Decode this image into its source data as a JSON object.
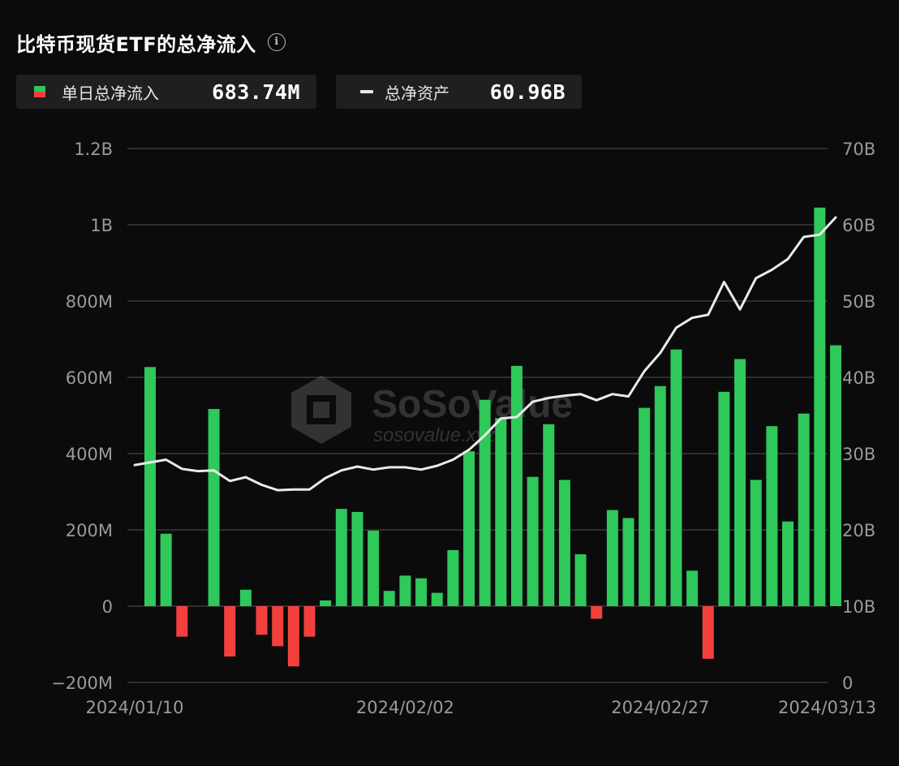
{
  "header": {
    "title": "比特币现货ETF的总净流入",
    "info_icon": "info-icon"
  },
  "legend": [
    {
      "label": "单日总净流入",
      "value": "683.74M",
      "swatch": "split-green-red"
    },
    {
      "label": "总净资产",
      "value": "60.96B",
      "swatch": "white-line"
    }
  ],
  "watermark": {
    "brand": "SoSoValue",
    "url": "sosovalue.xyz"
  },
  "colors": {
    "positive": "#2fc85a",
    "negative": "#f2413d",
    "line": "#eaeaea",
    "grid": "#3a3a3a",
    "tick": "#9a9a9a"
  },
  "chart_data": {
    "type": "bar",
    "series": [
      {
        "type": "bar",
        "axis": "left",
        "unit": "M",
        "values": [
          627,
          190,
          -80,
          0,
          517,
          -132,
          43,
          -75,
          -105,
          -158,
          -80,
          15,
          255,
          247,
          198,
          40,
          80,
          73,
          35,
          147,
          406,
          541,
          493,
          630,
          339,
          477,
          331,
          136,
          -33,
          252,
          231,
          520,
          577,
          673,
          93,
          -138,
          562,
          648,
          331,
          472,
          222,
          505,
          1045,
          684
        ]
      },
      {
        "type": "line",
        "axis": "right",
        "unit": "B",
        "values": [
          28.5,
          29.2,
          28.0,
          27.7,
          27.8,
          26.4,
          26.9,
          25.9,
          25.2,
          25.3,
          25.3,
          26.8,
          27.8,
          28.3,
          27.9,
          28.2,
          28.2,
          27.9,
          28.4,
          29.2,
          30.5,
          32.4,
          34.6,
          34.8,
          36.8,
          37.3,
          37.6,
          37.8,
          37.0,
          37.8,
          37.5,
          40.8,
          43.2,
          46.5,
          47.8,
          48.2,
          52.5,
          48.9,
          53.0,
          54.1,
          55.5,
          58.4,
          58.7,
          60.96
        ]
      }
    ],
    "x_ticks": [
      {
        "label": "2024/01/10",
        "index": 0
      },
      {
        "label": "2024/02/02",
        "index": 16
      },
      {
        "label": "2024/02/27",
        "index": 32
      },
      {
        "label": "2024/03/13",
        "index": 43
      }
    ],
    "left_axis": {
      "range": [
        -200,
        1200
      ],
      "ticks": [
        -200,
        0,
        200,
        400,
        600,
        800,
        1000,
        1200
      ],
      "tick_labels": [
        "−200M",
        "0",
        "200M",
        "400M",
        "600M",
        "800M",
        "1B",
        "1.2B"
      ]
    },
    "right_axis": {
      "range": [
        0,
        70
      ],
      "ticks": [
        0,
        10,
        20,
        30,
        40,
        50,
        60,
        70
      ],
      "tick_labels": [
        "0",
        "10B",
        "20B",
        "30B",
        "40B",
        "50B",
        "60B",
        "70B"
      ]
    },
    "grid": true
  }
}
